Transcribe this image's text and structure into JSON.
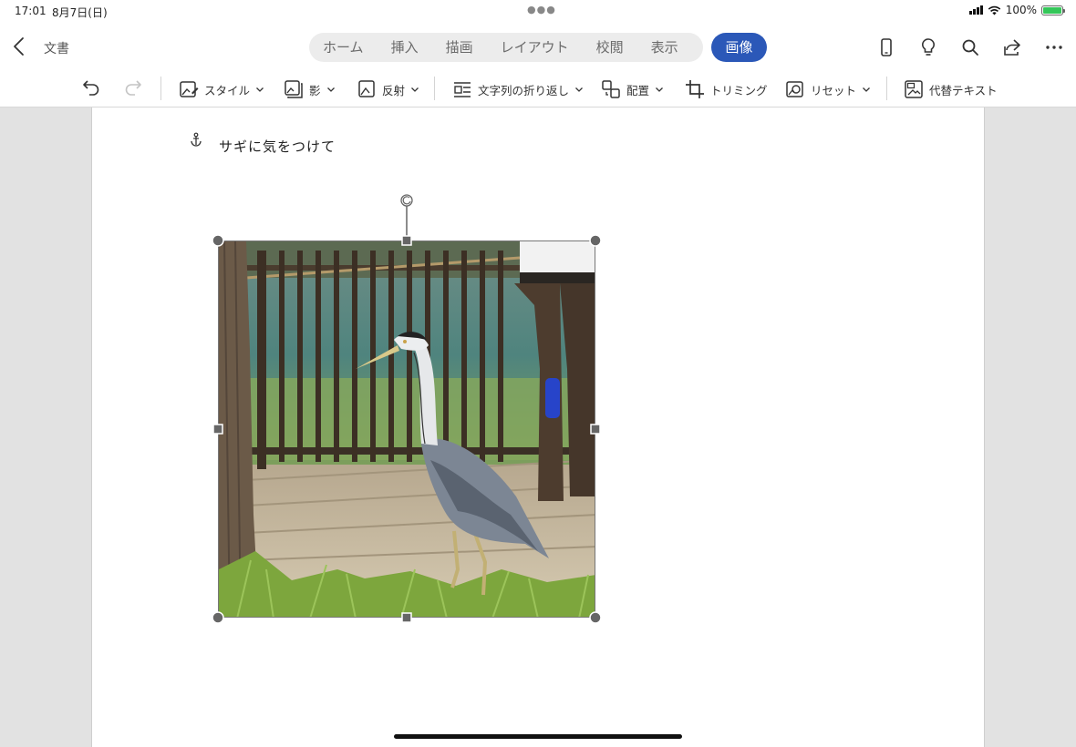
{
  "status_bar": {
    "time": "17:01",
    "date": "8月7日(日)",
    "battery": "100%"
  },
  "header": {
    "doc_title": "文書",
    "tabs": [
      "ホーム",
      "挿入",
      "描画",
      "レイアウト",
      "校閲",
      "表示"
    ],
    "active_tab": "画像",
    "accent_color": "#2b58b8"
  },
  "ribbon": {
    "style": "スタイル",
    "shadow": "影",
    "reflection": "反射",
    "wrap_text": "文字列の折り返し",
    "arrange": "配置",
    "crop": "トリミング",
    "reset": "リセット",
    "alt_text": "代替テキスト"
  },
  "document": {
    "text": "サギに気をつけて",
    "image_subject": "grey heron standing on a path in front of a railing"
  }
}
